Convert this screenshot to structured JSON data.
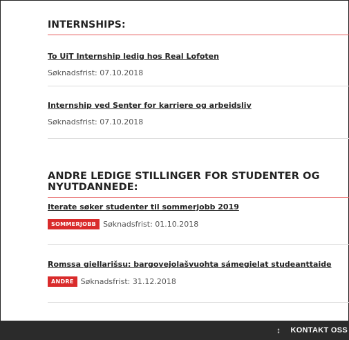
{
  "internships": {
    "title": "INTERNSHIPS:",
    "items": [
      {
        "title": "To UiT Internship ledig hos Real Lofoten",
        "deadline": "Søknadsfrist: 07.10.2018"
      },
      {
        "title": "Internship ved Senter for karriere og arbeidsliv",
        "deadline": "Søknadsfrist: 07.10.2018"
      }
    ]
  },
  "other_jobs": {
    "title": "ANDRE LEDIGE STILLINGER FOR STUDENTER OG NYUTDANNEDE:",
    "items": [
      {
        "title": "Iterate søker studenter til sommerjobb 2019",
        "tag": "SOMMERJOBB",
        "deadline": "Søknadsfrist: 01.10.2018"
      },
      {
        "title": "Romssa giellarišsu: bargovejolašvuohta sámegielat studeanttaide",
        "tag": "ANDRE",
        "deadline": "Søknadsfrist: 31.12.2018"
      }
    ]
  },
  "footer": {
    "contact_label": "KONTAKT OSS",
    "contact_icon": "up-down-arrow-icon"
  },
  "colors": {
    "accent": "#d92b2b",
    "footer_bg": "#2b2b2b"
  }
}
